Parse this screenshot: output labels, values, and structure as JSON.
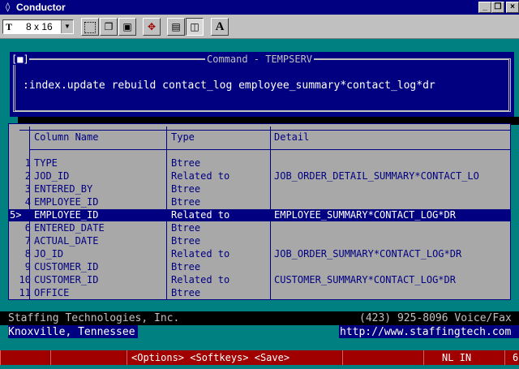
{
  "window": {
    "title": "Conductor"
  },
  "toolbar": {
    "font_size": "8 x 16",
    "buttons": [
      {
        "icon": "select-rect-icon"
      },
      {
        "icon": "copy-icon"
      },
      {
        "icon": "paste-icon"
      },
      {
        "icon": "move-icon"
      },
      {
        "icon": "properties-icon"
      },
      {
        "icon": "window-icon"
      },
      {
        "icon": "font-icon",
        "label": "A"
      }
    ]
  },
  "command_box": {
    "title": "Command - TEMPSERV",
    "close": "[■]",
    "text": ":index.update rebuild contact_log employee_summary*contact_log*dr"
  },
  "grid": {
    "headers": [
      "Column Name",
      "Type",
      "Detail"
    ],
    "rows": [
      {
        "num": "1",
        "name": "TYPE",
        "type": "Btree",
        "detail": ""
      },
      {
        "num": "2",
        "name": "JOD_ID",
        "type": "Related to",
        "detail": "JOB_ORDER_DETAIL_SUMMARY*CONTACT_LO"
      },
      {
        "num": "3",
        "name": "ENTERED_BY",
        "type": "Btree",
        "detail": ""
      },
      {
        "num": "4",
        "name": "EMPLOYEE_ID",
        "type": "Btree",
        "detail": ""
      },
      {
        "num": "5>",
        "name": "EMPLOYEE_ID",
        "type": "Related to",
        "detail": "EMPLOYEE_SUMMARY*CONTACT_LOG*DR",
        "selected": true
      },
      {
        "num": "6",
        "name": "ENTERED_DATE",
        "type": "Btree",
        "detail": ""
      },
      {
        "num": "7",
        "name": "ACTUAL_DATE",
        "type": "Btree",
        "detail": ""
      },
      {
        "num": "8",
        "name": "JO_ID",
        "type": "Related to",
        "detail": "JOB_ORDER_SUMMARY*CONTACT_LOG*DR"
      },
      {
        "num": "9",
        "name": "CUSTOMER_ID",
        "type": "Btree",
        "detail": ""
      },
      {
        "num": "10",
        "name": "CUSTOMER_ID",
        "type": "Related to",
        "detail": "CUSTOMER_SUMMARY*CONTACT_LOG*DR"
      },
      {
        "num": "11",
        "name": "OFFICE",
        "type": "Btree",
        "detail": ""
      }
    ]
  },
  "footer": {
    "company": "Staffing Technologies, Inc.",
    "phone": "(423) 925-8096 Voice/Fax",
    "city": "Knoxville, Tennessee",
    "url": "http://www.staffingtech.com"
  },
  "statusbar": {
    "keys": "<Options> <Softkeys> <Save>",
    "mode": "NL IN",
    "right": "6"
  },
  "colors": {
    "titlebar": "#000080",
    "terminal_bg": "#008080",
    "grid_bg": "#a8a8a8",
    "status_bg": "#a00000"
  }
}
